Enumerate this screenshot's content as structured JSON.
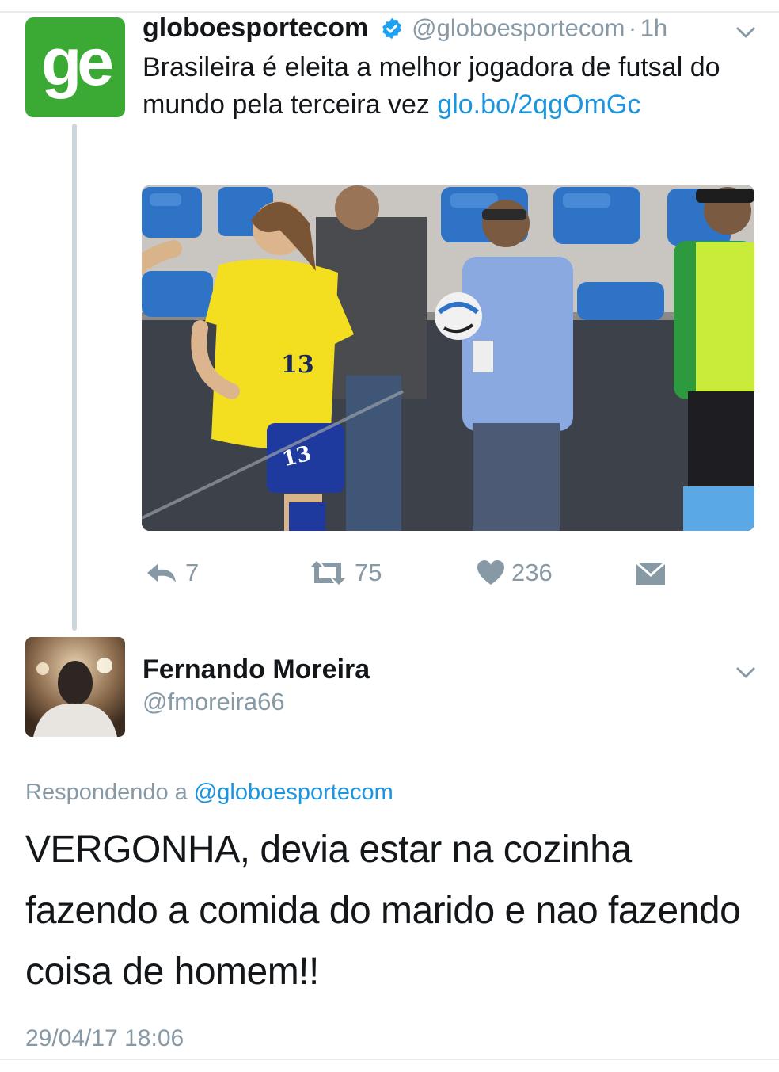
{
  "tweet": {
    "avatar_text": "ge",
    "display_name": "globoesportecom",
    "handle": "@globoesportecom",
    "separator": "·",
    "time_ago": "1h",
    "text": "Brasileira é eleita a melhor jogadora de futsal do mundo pela terceira vez ",
    "link": "glo.bo/2qgOmGc",
    "image_jersey_number": "13",
    "actions": {
      "replies": "7",
      "retweets": "75",
      "likes": "236"
    }
  },
  "reply": {
    "display_name": "Fernando Moreira",
    "handle": "@fmoreira66",
    "replying_prefix": "Respondendo a ",
    "replying_to": "@globoesportecom",
    "text": "VERGONHA, devia estar na cozinha fazendo a comida do marido e nao fazendo coisa de homem!!",
    "timestamp": "29/04/17 18:06"
  },
  "colors": {
    "brand_green": "#3aaa35",
    "link_blue": "#1b95e0",
    "secondary_gray": "#8899a6"
  },
  "icons": [
    "verified-badge-icon",
    "chevron-down-icon",
    "reply-icon",
    "retweet-icon",
    "heart-icon",
    "direct-message-icon"
  ]
}
